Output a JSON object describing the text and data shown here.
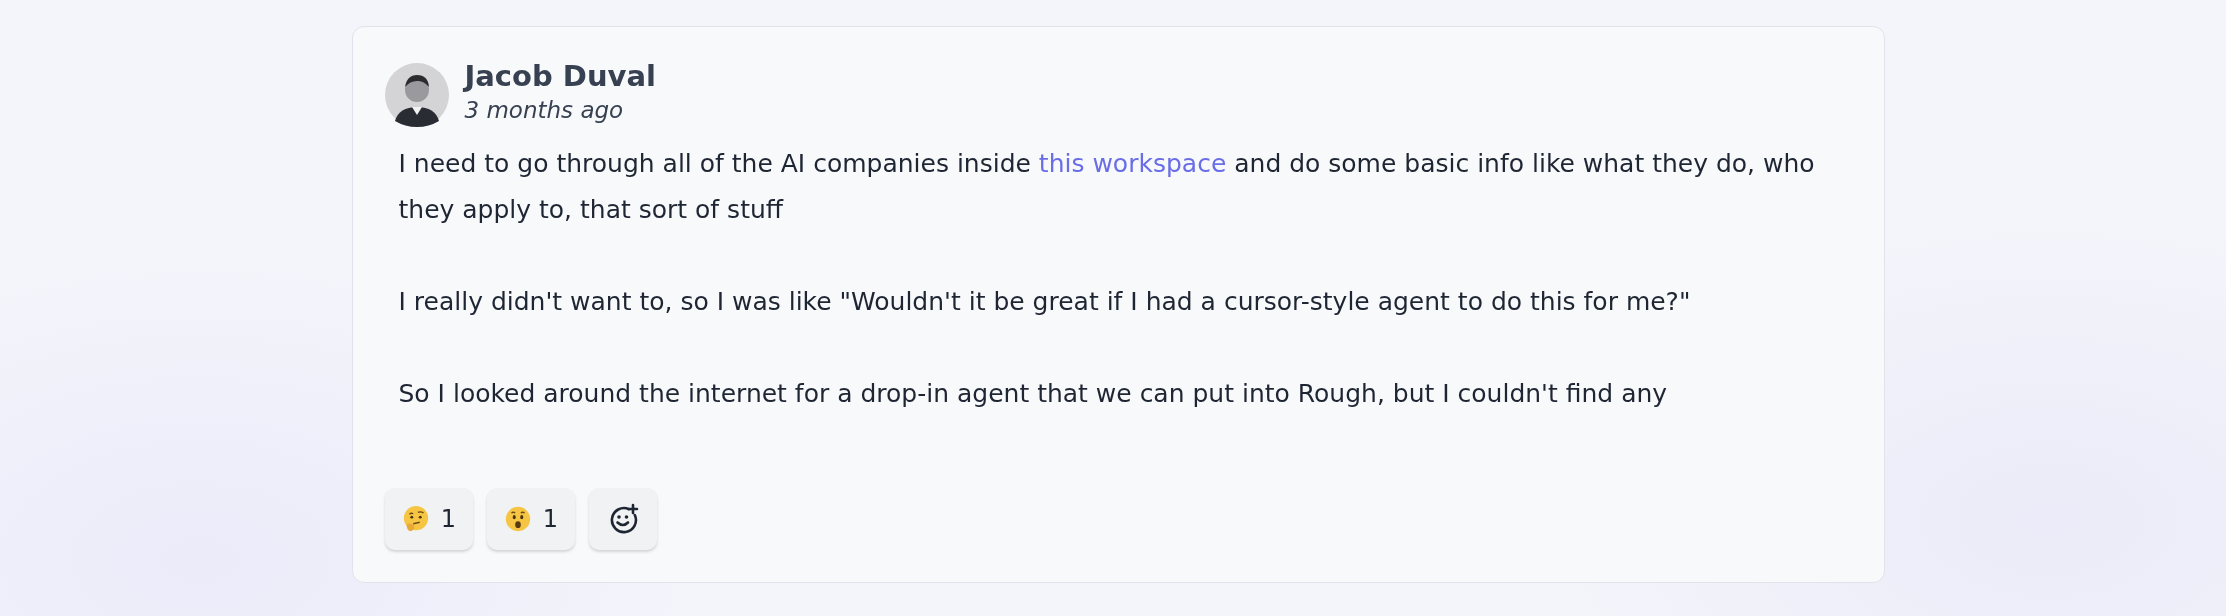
{
  "comment": {
    "author": "Jacob Duval",
    "time": "3 months ago",
    "paragraphs": [
      {
        "parts": [
          {
            "kind": "text",
            "text": "I need to go through all of the AI companies inside "
          },
          {
            "kind": "link",
            "text": "this workspace"
          },
          {
            "kind": "text",
            "text": " and do some basic info like what they do, who they apply to, that sort of stuff"
          }
        ]
      },
      {
        "parts": [
          {
            "kind": "text",
            "text": "I really didn't want to, so I was like \"Wouldn't it be great if I had a cursor-style agent to do this for me?\""
          }
        ]
      },
      {
        "parts": [
          {
            "kind": "text",
            "text": "So I looked around the internet for a drop-in agent that we can put into Rough, but I couldn't find any"
          }
        ]
      }
    ],
    "reactions": [
      {
        "kind": "thinking",
        "count": "1"
      },
      {
        "kind": "surprised",
        "count": "1"
      },
      {
        "kind": "add"
      }
    ]
  }
}
